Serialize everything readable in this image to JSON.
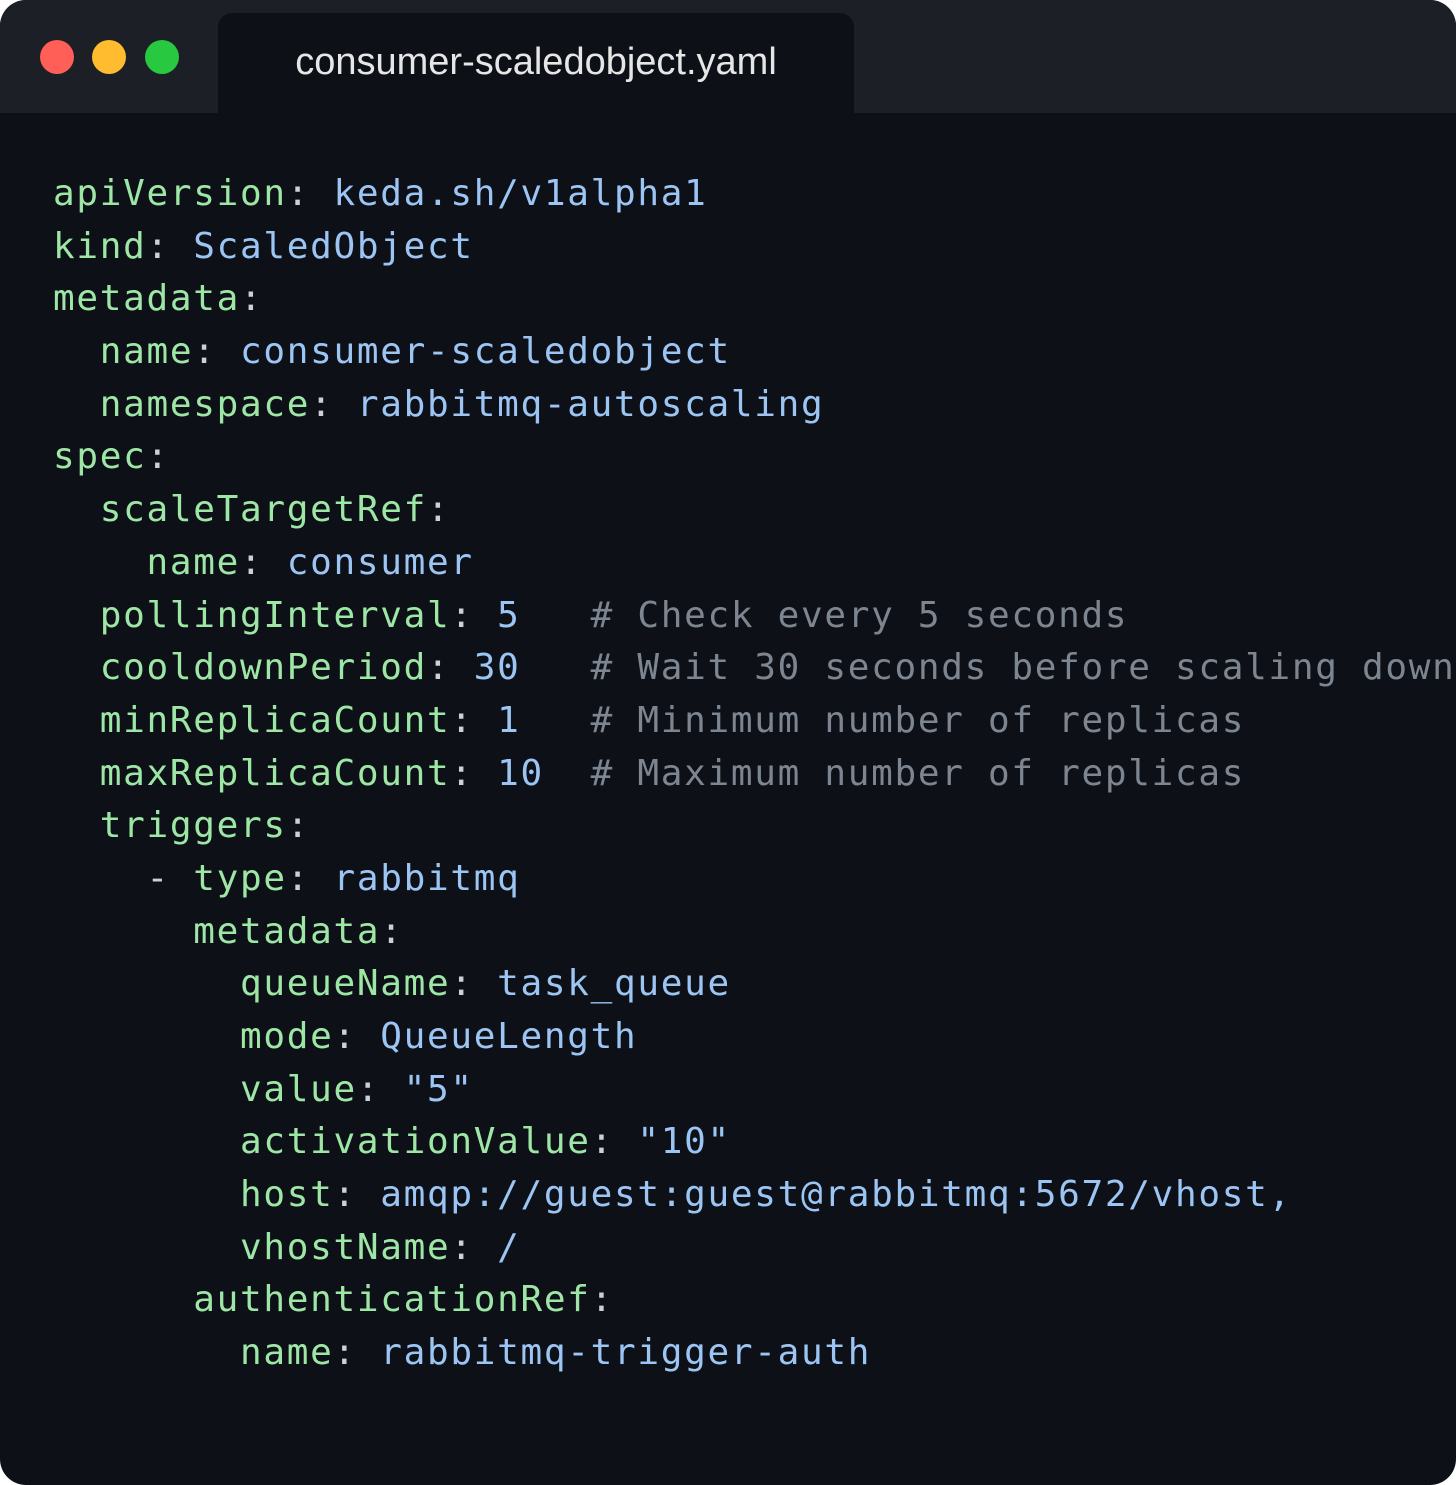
{
  "window": {
    "tab_title": "consumer-scaledobject.yaml"
  },
  "colors": {
    "background": "#0d1117",
    "titlebar": "#1c1f26",
    "key": "#9ee6a6",
    "value": "#9cc5f4",
    "comment": "#7d8590",
    "traffic_red": "#ff5f57",
    "traffic_yellow": "#febc2e",
    "traffic_green": "#28c840"
  },
  "code": {
    "language": "yaml",
    "lines": [
      {
        "indent": "",
        "key": "apiVersion",
        "value": "keda.sh/v1alpha1"
      },
      {
        "indent": "",
        "key": "kind",
        "value": "ScaledObject"
      },
      {
        "indent": "",
        "key": "metadata",
        "value": ""
      },
      {
        "indent": "  ",
        "key": "name",
        "value": "consumer-scaledobject"
      },
      {
        "indent": "  ",
        "key": "namespace",
        "value": "rabbitmq-autoscaling"
      },
      {
        "indent": "",
        "key": "spec",
        "value": ""
      },
      {
        "indent": "  ",
        "key": "scaleTargetRef",
        "value": ""
      },
      {
        "indent": "    ",
        "key": "name",
        "value": "consumer"
      },
      {
        "indent": "  ",
        "key": "pollingInterval",
        "value": "5",
        "pad": "   ",
        "comment": "# Check every 5 seconds"
      },
      {
        "indent": "  ",
        "key": "cooldownPeriod",
        "value": "30",
        "pad": "   ",
        "comment": "# Wait 30 seconds before scaling down"
      },
      {
        "indent": "  ",
        "key": "minReplicaCount",
        "value": "1",
        "pad": "   ",
        "comment": "# Minimum number of replicas"
      },
      {
        "indent": "  ",
        "key": "maxReplicaCount",
        "value": "10",
        "pad": "  ",
        "comment": "# Maximum number of replicas"
      },
      {
        "indent": "  ",
        "key": "triggers",
        "value": ""
      },
      {
        "indent": "    ",
        "dash": "- ",
        "key": "type",
        "value": "rabbitmq"
      },
      {
        "indent": "      ",
        "key": "metadata",
        "value": ""
      },
      {
        "indent": "        ",
        "key": "queueName",
        "value": "task_queue"
      },
      {
        "indent": "        ",
        "key": "mode",
        "value": "QueueLength"
      },
      {
        "indent": "        ",
        "key": "value",
        "value": "\"5\""
      },
      {
        "indent": "        ",
        "key": "activationValue",
        "value": "\"10\""
      },
      {
        "indent": "        ",
        "key": "host",
        "value": "amqp://guest:guest@rabbitmq:5672/vhost,"
      },
      {
        "indent": "        ",
        "key": "vhostName",
        "value": "/"
      },
      {
        "indent": "      ",
        "key": "authenticationRef",
        "value": ""
      },
      {
        "indent": "        ",
        "key": "name",
        "value": "rabbitmq-trigger-auth"
      }
    ]
  }
}
